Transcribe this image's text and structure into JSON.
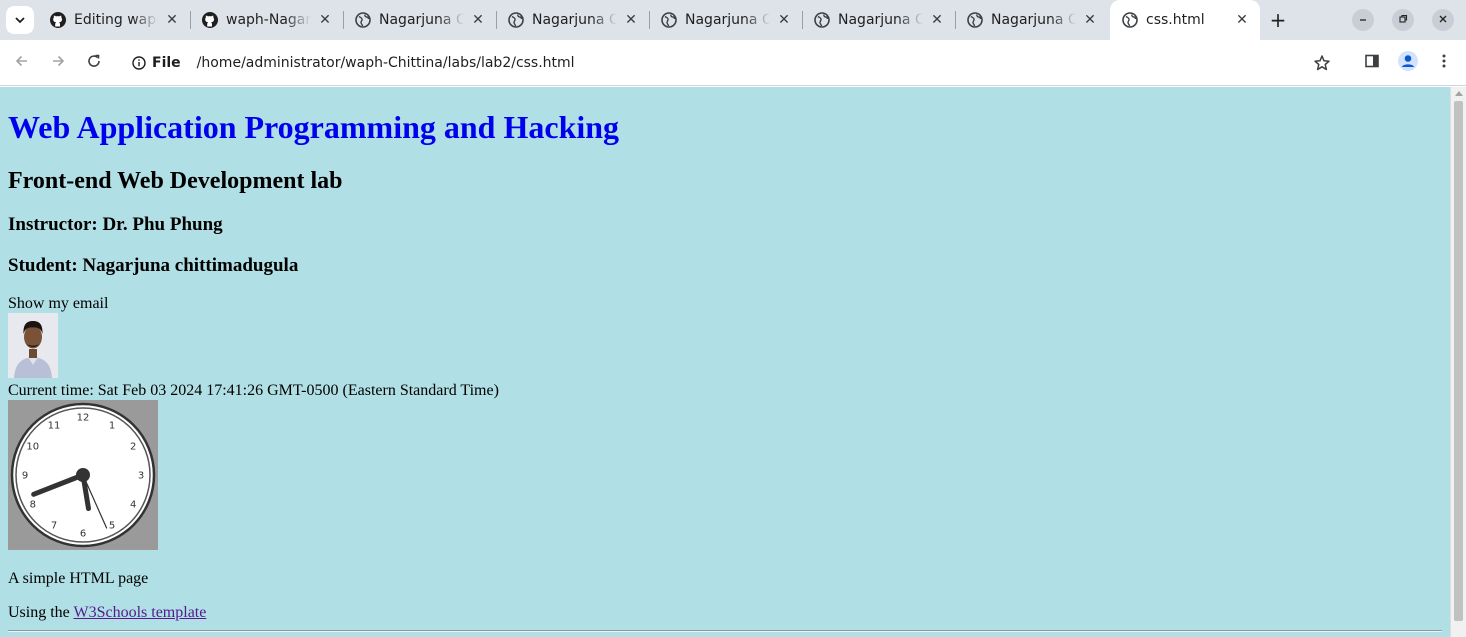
{
  "browser": {
    "tabs": [
      {
        "title": "Editing waph-Chittina",
        "favicon": "github-icon",
        "active": false
      },
      {
        "title": "waph-Nagarjuna",
        "favicon": "github-icon",
        "active": false
      },
      {
        "title": "Nagarjuna Chittimadugula",
        "favicon": "globe-icon",
        "active": false
      },
      {
        "title": "Nagarjuna Chittimadugula",
        "favicon": "globe-icon",
        "active": false
      },
      {
        "title": "Nagarjuna Chittimadugula",
        "favicon": "globe-icon",
        "active": false
      },
      {
        "title": "Nagarjuna Chittimadugula",
        "favicon": "globe-icon",
        "active": false
      },
      {
        "title": "Nagarjuna Chittimadugula",
        "favicon": "globe-icon",
        "active": false
      },
      {
        "title": "css.html",
        "favicon": "globe-icon",
        "active": true
      }
    ],
    "omnibox": {
      "chip_label": "File",
      "url": "/home/administrator/waph-Chittina/labs/lab2/css.html"
    },
    "colors": {
      "tabstrip": "#dee3ea",
      "page_background": "#b0dfe5",
      "heading_link": "#0000ee",
      "visited_link": "#551a8b"
    }
  },
  "page": {
    "title": "Web Application Programming and Hacking",
    "subtitle": "Front-end Web Development lab",
    "instructor": "Instructor: Dr. Phu Phung",
    "student": "Student: Nagarjuna chittimadugula",
    "email_toggle": "Show my email",
    "current_time": "Current time: Sat Feb 03 2024 17:41:26 GMT-0500 (Eastern Standard Time)",
    "clock": {
      "numbers": [
        "12",
        "1",
        "2",
        "3",
        "4",
        "5",
        "6",
        "7",
        "8",
        "9",
        "10",
        "11"
      ],
      "hour": 5,
      "minute": 41,
      "second": 26
    },
    "simple_text": "A simple HTML page",
    "using_prefix": "Using the ",
    "template_link": "W3Schools template"
  }
}
